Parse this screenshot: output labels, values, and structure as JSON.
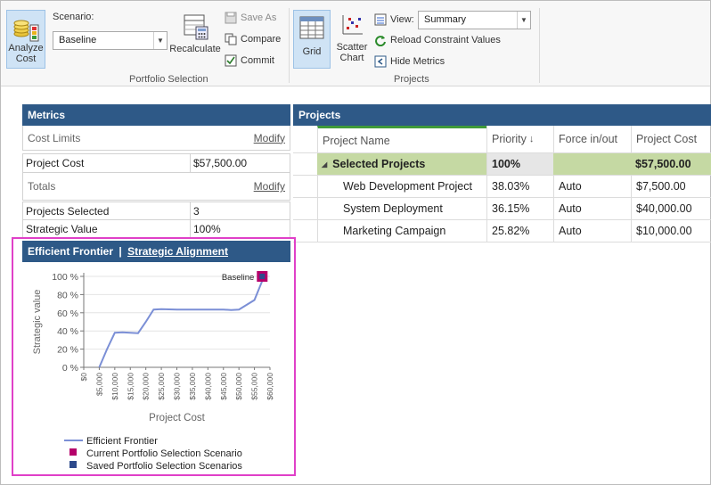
{
  "ribbon": {
    "analyze": {
      "label_line1": "Analyze",
      "label_line2": "Cost"
    },
    "scenario": {
      "label": "Scenario:",
      "value": "Baseline"
    },
    "recalculate": "Recalculate",
    "save_as": "Save As",
    "compare": "Compare",
    "commit": "Commit",
    "group1_label": "Portfolio Selection",
    "grid": "Grid",
    "scatter": {
      "line1": "Scatter",
      "line2": "Chart"
    },
    "view": {
      "label": "View:",
      "value": "Summary"
    },
    "reload": "Reload Constraint Values",
    "hide_metrics": "Hide Metrics",
    "group2_label": "Projects"
  },
  "metrics": {
    "title": "Metrics",
    "cost_limits": "Cost Limits",
    "modify": "Modify",
    "project_cost_label": "Project Cost",
    "project_cost_value": "$57,500.00",
    "totals": "Totals",
    "projects_selected_label": "Projects Selected",
    "projects_selected_value": "3",
    "strategic_value_label": "Strategic Value",
    "strategic_value_value": "100%"
  },
  "projects": {
    "title": "Projects",
    "columns": [
      "Project Name",
      "Priority",
      "Force in/out",
      "Project Cost"
    ],
    "group_row": {
      "name": "Selected Projects",
      "priority": "100%",
      "cost": "$57,500.00"
    },
    "rows": [
      {
        "name": "Web Development Project",
        "priority": "38.03%",
        "force": "Auto",
        "cost": "$7,500.00"
      },
      {
        "name": "System Deployment",
        "priority": "36.15%",
        "force": "Auto",
        "cost": "$40,000.00"
      },
      {
        "name": "Marketing Campaign",
        "priority": "25.82%",
        "force": "Auto",
        "cost": "$10,000.00"
      }
    ]
  },
  "chart_header": {
    "left": "Efficient Frontier",
    "sep": "|",
    "right": "Strategic Alignment"
  },
  "colors": {
    "header_blue": "#2e5987",
    "group_green": "#c5d9a3",
    "line": "#7b8fd6",
    "current": "#b5006a",
    "saved": "#2e4a8c",
    "highlight": "#e040c8"
  },
  "chart_data": {
    "type": "line",
    "xlabel": "Project Cost",
    "ylabel": "Strategic value",
    "xlim": [
      0,
      60000
    ],
    "ylim": [
      0,
      100
    ],
    "x_ticks": [
      "$0",
      "$5,000",
      "$10,000",
      "$15,000",
      "$20,000",
      "$25,000",
      "$30,000",
      "$35,000",
      "$40,000",
      "$45,000",
      "$50,000",
      "$55,000",
      "$60,000"
    ],
    "y_ticks": [
      "0 %",
      "20 %",
      "40 %",
      "60 %",
      "80 %",
      "100 %"
    ],
    "series": [
      {
        "name": "Efficient Frontier",
        "x": [
          5000,
          7500,
          10000,
          12500,
          15000,
          17500,
          20000,
          22500,
          25000,
          30000,
          35000,
          40000,
          45000,
          47500,
          50000,
          55000,
          57500
        ],
        "y": [
          0,
          20,
          38,
          38.5,
          38,
          37.5,
          50,
          63.5,
          64,
          63.5,
          63.5,
          63.5,
          63.5,
          63,
          63.5,
          74,
          95
        ]
      }
    ],
    "current_point": {
      "x": 57500,
      "y": 100,
      "label": "Baseline"
    },
    "legend": {
      "line": "Efficient Frontier",
      "current": "Current Portfolio Selection Scenario",
      "saved": "Saved Portfolio Selection Scenarios"
    },
    "legend_position": "bottom-left",
    "grid": "horizontal"
  }
}
